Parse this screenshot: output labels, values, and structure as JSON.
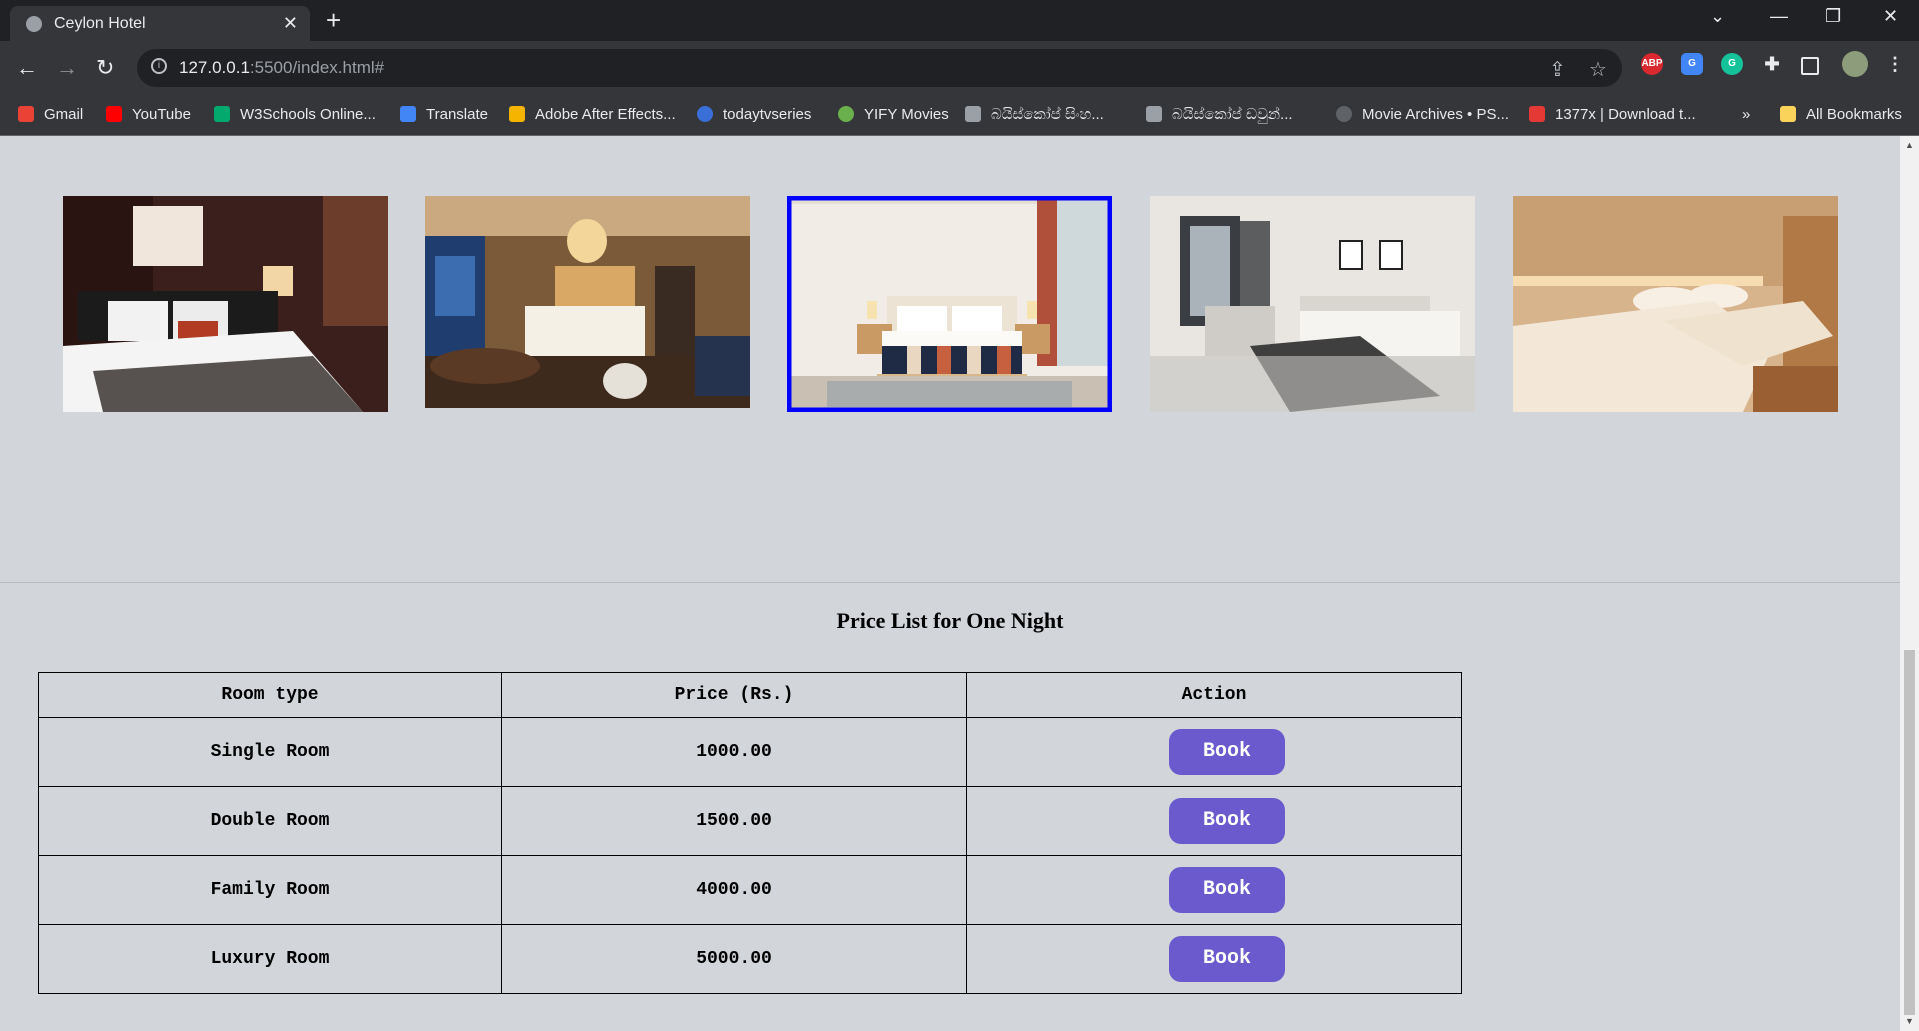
{
  "browser": {
    "tab_title": "Ceylon Hotel",
    "url_host": "127.0.0.1",
    "url_path": ":5500/index.html#",
    "bookmarks": [
      {
        "label": "Gmail",
        "color": "#ea4335"
      },
      {
        "label": "YouTube",
        "color": "#ff0000"
      },
      {
        "label": "W3Schools Online...",
        "color": "#04aa6d"
      },
      {
        "label": "Translate",
        "color": "#4285f4"
      },
      {
        "label": "Adobe After Effects...",
        "color": "#f4b400"
      },
      {
        "label": "todaytvseries",
        "color": "#3b6fd8"
      },
      {
        "label": "YIFY Movies",
        "color": "#6ab04c"
      },
      {
        "label": "බයිස්කෝප් සිංහ...",
        "color": "#9aa0a6"
      },
      {
        "label": "බයිස්කෝප් ඩවුන්...",
        "color": "#9aa0a6"
      },
      {
        "label": "Movie Archives • PS...",
        "color": "#5f6368"
      },
      {
        "label": "1377x | Download t...",
        "color": "#e53935"
      }
    ],
    "overflow": "»",
    "all_bookmarks": "All Bookmarks",
    "extensions": [
      {
        "name": "adblock-icon",
        "label": "ABP",
        "color": "#d9282f"
      },
      {
        "name": "translate-icon",
        "label": "G",
        "color": "#4285f4"
      },
      {
        "name": "grammarly-icon",
        "label": "G",
        "color": "#15c39a"
      }
    ]
  },
  "gallery": {
    "images": [
      {
        "name": "room-photo-1",
        "selected": false
      },
      {
        "name": "room-photo-2",
        "selected": false
      },
      {
        "name": "room-photo-3",
        "selected": true
      },
      {
        "name": "room-photo-4",
        "selected": false
      },
      {
        "name": "room-photo-5",
        "selected": false
      }
    ]
  },
  "price_list": {
    "title": "Price List for One Night",
    "headers": [
      "Room type",
      "Price (Rs.)",
      "Action"
    ],
    "rows": [
      {
        "room": "Single Room",
        "price": "1000.00",
        "action": "Book"
      },
      {
        "room": "Double Room",
        "price": "1500.00",
        "action": "Book"
      },
      {
        "room": "Family Room",
        "price": "4000.00",
        "action": "Book"
      },
      {
        "room": "Luxury Room",
        "price": "5000.00",
        "action": "Book"
      }
    ]
  },
  "colors": {
    "page_bg": "#d2d5d9",
    "button": "#6a5acd",
    "selected_border": "#0000ff"
  }
}
